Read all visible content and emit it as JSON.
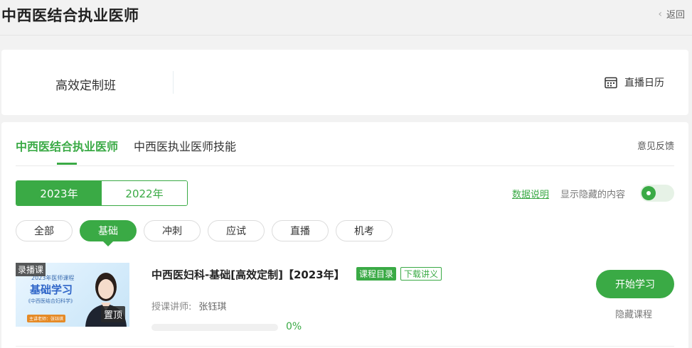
{
  "header": {
    "title": "中西医结合执业医师",
    "back_label": "返回"
  },
  "class_card": {
    "name": "高效定制班",
    "calendar_label": "直播日历"
  },
  "tabs": [
    {
      "label": "中西医结合执业医师",
      "active": true
    },
    {
      "label": "中西医执业医师技能",
      "active": false
    }
  ],
  "feedback_label": "意见反馈",
  "years": [
    {
      "label": "2023年",
      "active": true
    },
    {
      "label": "2022年",
      "active": false
    }
  ],
  "data_link": "数据说明",
  "show_hidden_label": "显示隐藏的内容",
  "filters": [
    {
      "label": "全部",
      "active": false
    },
    {
      "label": "基础",
      "active": true
    },
    {
      "label": "冲刺",
      "active": false
    },
    {
      "label": "应试",
      "active": false
    },
    {
      "label": "直播",
      "active": false
    },
    {
      "label": "机考",
      "active": false
    }
  ],
  "course": {
    "thumb": {
      "badge": "录播课",
      "line1": "2023年医师课程",
      "line2": "基础学习",
      "line3": "《中西医结合妇科学》",
      "line4": "主讲老师：张钰琪",
      "pin": "置顶"
    },
    "title": "中西医妇科-基础[高效定制]【2023年】",
    "tag_catalog": "课程目录",
    "tag_download": "下载讲义",
    "teacher_label": "授课讲师:",
    "teacher_name": "张钰琪",
    "progress_value": 0,
    "progress_text": "0%",
    "start_button": "开始学习",
    "hide_button": "隐藏课程"
  },
  "colors": {
    "accent": "#3aaa45",
    "background": "#f2f2f2"
  },
  "icons": {
    "back": "chevron-left-icon",
    "calendar": "calendar-icon",
    "toggle": "toggle-switch"
  }
}
